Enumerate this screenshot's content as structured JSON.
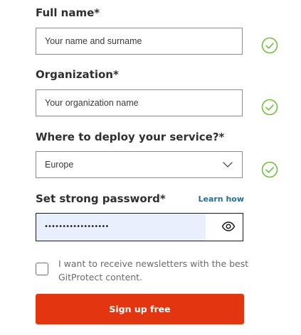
{
  "form": {
    "full_name": {
      "label": "Full name*",
      "placeholder": "Your name and surname",
      "valid_icon": "check-circle-icon"
    },
    "organization": {
      "label": "Organization*",
      "placeholder": "Your organization name",
      "valid_icon": "check-circle-icon"
    },
    "deploy": {
      "label": "Where to deploy your service?*",
      "selected": "Europe",
      "valid_icon": "check-circle-icon"
    },
    "password": {
      "label": "Set strong password*",
      "learn_link": "Learn how",
      "masked_value": "••••••••••••••••••",
      "toggle_icon": "eye-icon"
    },
    "newsletter": {
      "checked": false,
      "text": "I want to receive newsletters with the best GitProtect content."
    },
    "submit_label": "Sign up free"
  },
  "colors": {
    "accent": "#e3350f",
    "valid": "#6fbf3b",
    "link": "#1f6f96",
    "autofill": "#e8f0fe"
  }
}
